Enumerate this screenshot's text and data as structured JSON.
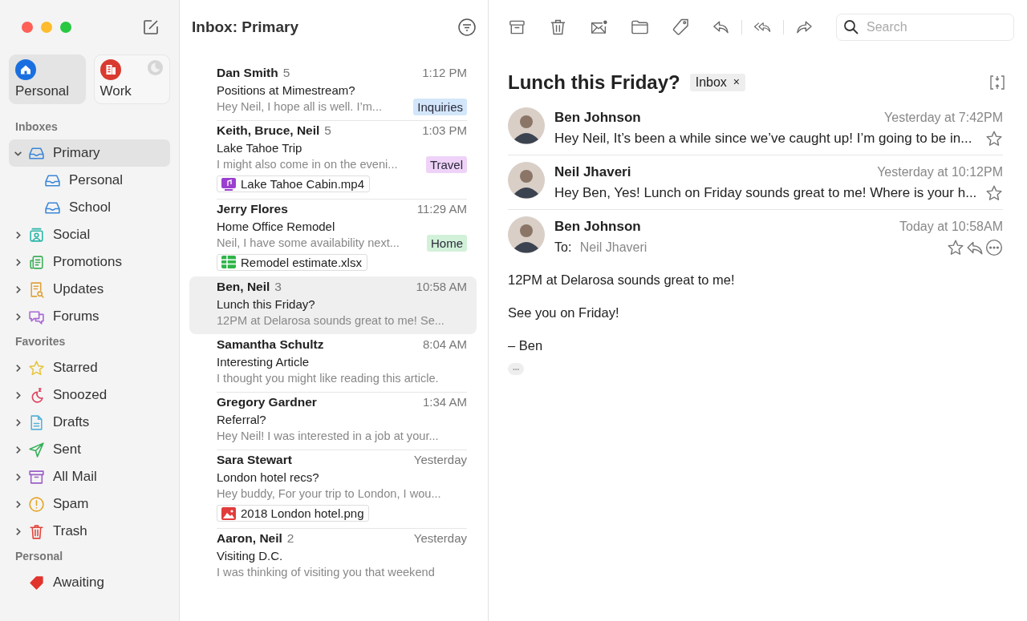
{
  "accounts": [
    {
      "label": "Personal",
      "selected": true
    },
    {
      "label": "Work",
      "selected": false
    }
  ],
  "sidebar": {
    "sections": [
      {
        "heading": "Inboxes",
        "items": [
          {
            "label": "Primary",
            "expanded": true,
            "selected": true,
            "children": [
              {
                "label": "Personal",
                "selected": false
              },
              {
                "label": "School",
                "selected": false
              }
            ]
          },
          {
            "label": "Social",
            "expanded": false,
            "selected": false
          },
          {
            "label": "Promotions",
            "expanded": false,
            "selected": false
          },
          {
            "label": "Updates",
            "expanded": false,
            "selected": false
          },
          {
            "label": "Forums",
            "expanded": false,
            "selected": false
          }
        ]
      },
      {
        "heading": "Favorites",
        "items": [
          {
            "label": "Starred",
            "expanded": false,
            "selected": false
          },
          {
            "label": "Snoozed",
            "expanded": false,
            "selected": false
          },
          {
            "label": "Drafts",
            "expanded": false,
            "selected": false
          },
          {
            "label": "Sent",
            "expanded": false,
            "selected": false
          },
          {
            "label": "All Mail",
            "expanded": false,
            "selected": false
          },
          {
            "label": "Spam",
            "expanded": false,
            "selected": false
          },
          {
            "label": "Trash",
            "expanded": false,
            "selected": false
          }
        ]
      },
      {
        "heading": "Personal",
        "items": [
          {
            "label": "Awaiting",
            "selected": false
          }
        ]
      }
    ]
  },
  "message_list": {
    "title": "Inbox: Primary",
    "messages": [
      {
        "sender": "Dan Smith",
        "count": "5",
        "time": "1:12 PM",
        "subject": "Positions at Mimestream?",
        "preview": "Hey Neil, I hope all is well. I’m...",
        "tag": {
          "label": "Inquiries",
          "color": "#d3e6fa"
        },
        "selected": false
      },
      {
        "sender": "Keith, Bruce, Neil",
        "count": "5",
        "time": "1:03 PM",
        "subject": "Lake Tahoe Trip",
        "preview": "I might also come in on the eveni...",
        "tag": {
          "label": "Travel",
          "color": "#efd2f8"
        },
        "attachment": {
          "kind": "video",
          "name": "Lake Tahoe Cabin.mp4"
        },
        "selected": false
      },
      {
        "sender": "Jerry Flores",
        "time": "11:29 AM",
        "subject": "Home Office Remodel",
        "preview": "Neil, I have some availability next...",
        "tag": {
          "label": "Home",
          "color": "#d2f1d9"
        },
        "attachment": {
          "kind": "spreadsheet",
          "name": "Remodel estimate.xlsx"
        },
        "selected": false
      },
      {
        "sender": "Ben, Neil",
        "count": "3",
        "time": "10:58 AM",
        "subject": "Lunch this Friday?",
        "preview": "12PM at Delarosa sounds great to me! Se...",
        "selected": true
      },
      {
        "sender": "Samantha Schultz",
        "time": "8:04 AM",
        "subject": "Interesting Article",
        "preview": "I thought you might like reading this article.",
        "selected": false
      },
      {
        "sender": "Gregory Gardner",
        "time": "1:34 AM",
        "subject": "Referral?",
        "preview": "Hey Neil! I was interested in a job at your...",
        "selected": false
      },
      {
        "sender": "Sara Stewart",
        "time": "Yesterday",
        "subject": "London hotel recs?",
        "preview": "Hey buddy, For your trip to London, I wou...",
        "attachment": {
          "kind": "image",
          "name": "2018 London hotel.png"
        },
        "selected": false
      },
      {
        "sender": "Aaron, Neil",
        "count": "2",
        "time": "Yesterday",
        "subject": "Visiting D.C.",
        "preview": "I was thinking of visiting you that weekend",
        "selected": false
      }
    ]
  },
  "reader": {
    "search": {
      "placeholder": "Search"
    },
    "subject": "Lunch this Friday?",
    "label": "Inbox",
    "label_remove": "×",
    "collapsed": [
      {
        "sender": "Ben Johnson",
        "time": "Yesterday at 7:42PM",
        "preview": "Hey Neil, It’s been a while since we’ve caught up! I’m going to be in...",
        "starred": false
      },
      {
        "sender": "Neil Jhaveri",
        "time": "Yesterday at 10:12PM",
        "preview": "Hey Ben, Yes! Lunch on Friday sounds great to me! Where is your h...",
        "starred": false
      }
    ],
    "open": {
      "sender": "Ben Johnson",
      "time": "Today at 10:58AM",
      "to_label": "To:",
      "to": "Neil Jhaveri",
      "starred": false,
      "body": [
        "12PM at Delarosa sounds great to me!",
        "See you on Friday!",
        "– Ben"
      ],
      "more": "•••"
    }
  }
}
